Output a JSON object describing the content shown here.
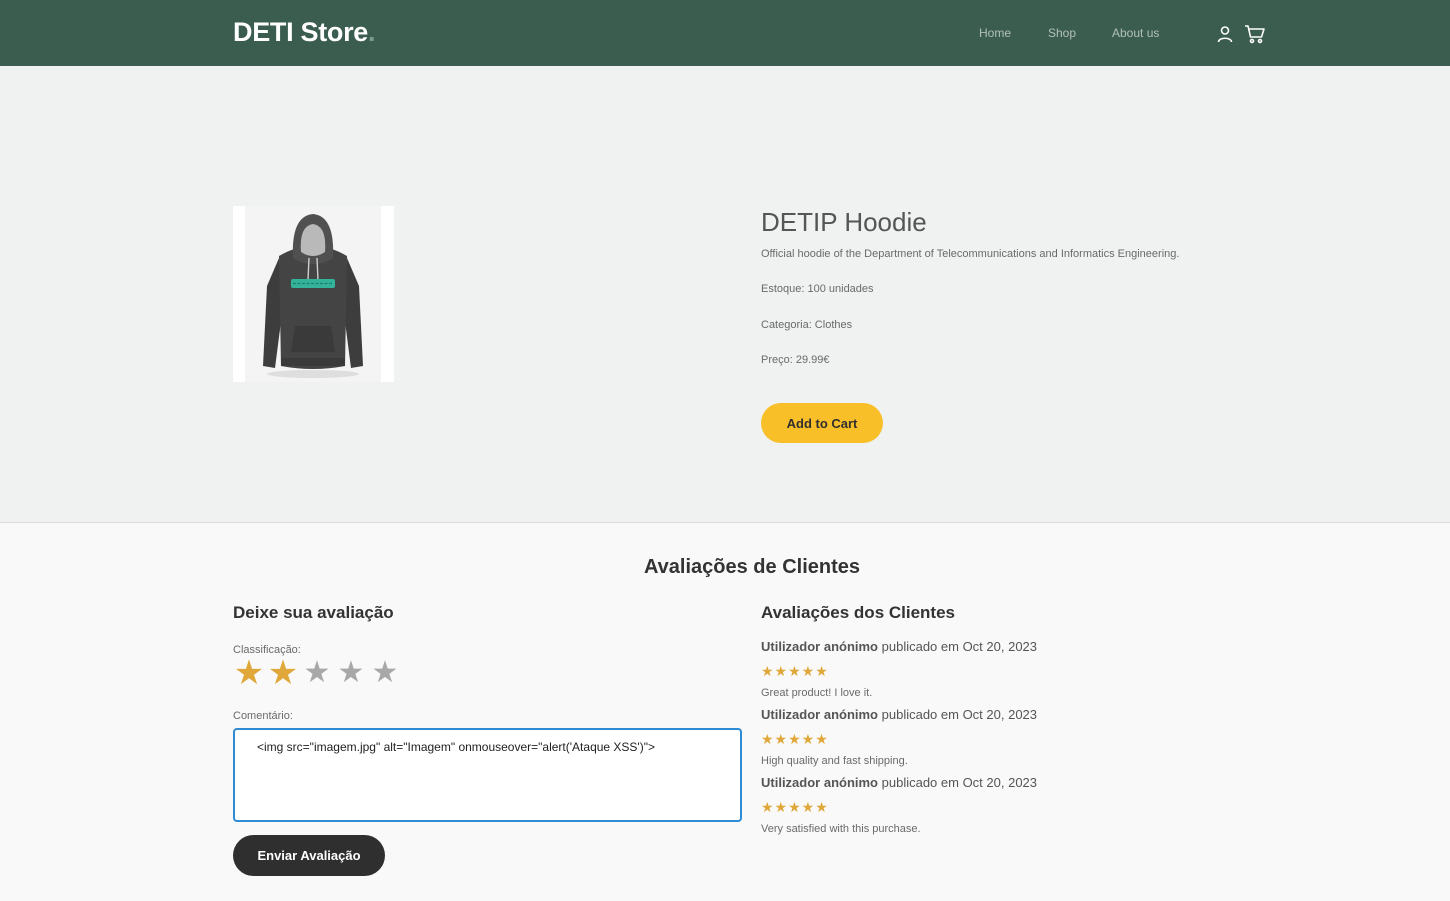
{
  "nav": {
    "brand": "DETI Store",
    "brand_dot": ".",
    "links": [
      "Home",
      "Shop",
      "About us"
    ],
    "icons": [
      "user-icon",
      "cart-icon"
    ]
  },
  "product": {
    "image_alt": "DETIP Hoodie image",
    "title": "DETIP Hoodie",
    "description": "Official hoodie of the Department of Telecommunications and Informatics Engineering.",
    "stock": "Estoque: 100 unidades",
    "category": "Categoria: Clothes",
    "price": "Preço: 29.99€",
    "add_to_cart": "Add to Cart"
  },
  "reviews_section": {
    "title": "Avaliações de Clientes",
    "form": {
      "heading": "Deixe sua avaliação",
      "rating_label": "Classificação:",
      "rating": 2,
      "rating_max": 5,
      "comment_label": "Comentário:",
      "comment_value": "<img src=\"imagem.jpg\" alt=\"Imagem\" onmouseover=\"alert('Ataque XSS')\"> ",
      "submit": "Enviar Avaliação"
    },
    "list_heading": "Avaliações dos Clientes",
    "items": [
      {
        "author": "Utilizador anónimo",
        "published": "publicado em Oct 20, 2023",
        "stars": "★★★★★",
        "rating": 5,
        "text": "Great product! I love it."
      },
      {
        "author": "Utilizador anónimo",
        "published": "publicado em Oct 20, 2023",
        "stars": "★★★★★",
        "rating": 5,
        "text": "High quality and fast shipping."
      },
      {
        "author": "Utilizador anónimo",
        "published": "publicado em Oct 20, 2023",
        "stars": "★★★★★",
        "rating": 5,
        "text": "Very satisfied with this purchase."
      }
    ]
  },
  "colors": {
    "navbar": "#3b5d50",
    "hero_bg": "#eff2f1",
    "accent_yellow": "#f9bf29",
    "star_gold": "#e0a83a",
    "button_dark": "#2f2f2f",
    "focus_blue": "#2f8bd3"
  }
}
